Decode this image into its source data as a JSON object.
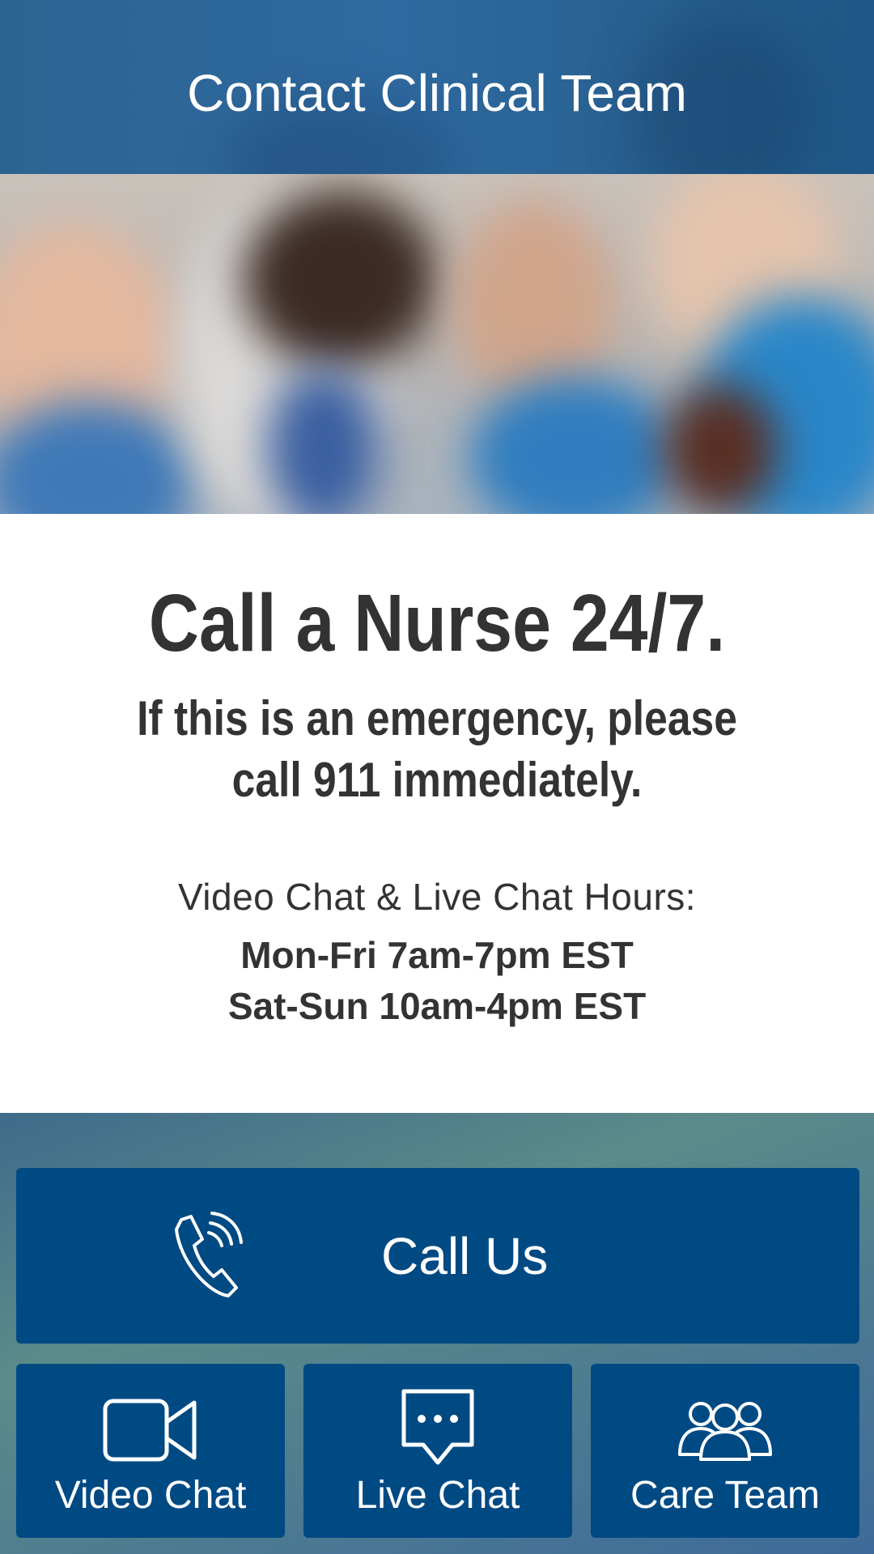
{
  "header": {
    "title": "Contact Clinical Team"
  },
  "hero": {
    "description_icon": "photo-of-clinical-team"
  },
  "info": {
    "headline": "Call a Nurse 24/7.",
    "emergency_line1": "If this is an emergency, please",
    "emergency_line2": "call 911 immediately.",
    "hours_label": "Video Chat & Live Chat Hours:",
    "hours": [
      "Mon-Fri 7am-7pm EST",
      "Sat-Sun 10am-4pm EST"
    ]
  },
  "actions": {
    "call": {
      "label": "Call Us",
      "icon": "phone-icon"
    },
    "video": {
      "label": "Video Chat",
      "icon": "video-camera-icon"
    },
    "live": {
      "label": "Live Chat",
      "icon": "chat-bubble-icon"
    },
    "care": {
      "label": "Care Team",
      "icon": "group-icon"
    }
  },
  "colors": {
    "primary": "#004a84",
    "header": "#2d6391",
    "text": "#333333"
  }
}
